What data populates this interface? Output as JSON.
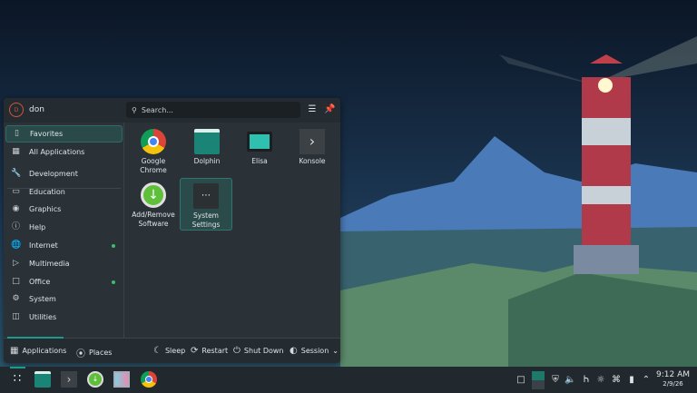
{
  "menu": {
    "user": "don",
    "avatar_initial": "D",
    "search_placeholder": "Search...",
    "sidebar": [
      {
        "label": "Favorites",
        "icon": "bookmark-icon",
        "selected": true
      },
      {
        "label": "All Applications",
        "icon": "grid-icon"
      },
      {
        "label": "Development",
        "icon": "wrench-icon"
      },
      {
        "label": "Education",
        "icon": "monitor-icon"
      },
      {
        "label": "Graphics",
        "icon": "palette-icon"
      },
      {
        "label": "Help",
        "icon": "help-icon"
      },
      {
        "label": "Internet",
        "icon": "globe-icon",
        "new": true
      },
      {
        "label": "Multimedia",
        "icon": "multimedia-icon"
      },
      {
        "label": "Office",
        "icon": "office-icon",
        "new": true
      },
      {
        "label": "System",
        "icon": "gear-icon"
      },
      {
        "label": "Utilities",
        "icon": "toolbox-icon"
      }
    ],
    "apps": [
      {
        "label": "Google Chrome"
      },
      {
        "label": "Dolphin"
      },
      {
        "label": "Elisa"
      },
      {
        "label": "Konsole"
      },
      {
        "label": "Add/Remove Software"
      },
      {
        "label": "System Settings",
        "selected": true
      }
    ],
    "footer": {
      "applications": "Applications",
      "places": "Places",
      "sleep": "Sleep",
      "restart": "Restart",
      "shutdown": "Shut Down",
      "session": "Session"
    }
  },
  "taskbar": {
    "time": "9:12 AM",
    "date": "2/9/26"
  },
  "colors": {
    "accent": "#1d9a8a",
    "panel": "#2a3238",
    "taskbar": "#22292e"
  }
}
